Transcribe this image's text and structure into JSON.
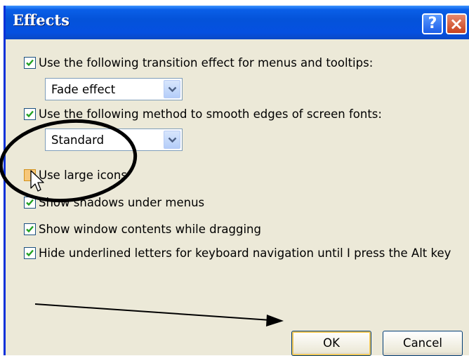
{
  "dialog": {
    "title": "Effects",
    "help_button": "?",
    "close_button": "×"
  },
  "options": {
    "transition_effect": {
      "label": "Use the following transition effect for menus and tooltips:",
      "checked": true,
      "selected": "Fade effect"
    },
    "smooth_edges": {
      "label": "Use the following method to smooth edges of screen fonts:",
      "checked": true,
      "selected": "Standard"
    },
    "large_icons": {
      "label": "Use large icons",
      "checked": false
    },
    "shadows": {
      "label": "Show shadows under menus",
      "checked": true
    },
    "window_contents": {
      "label": "Show window contents while dragging",
      "checked": true
    },
    "underlined_letters": {
      "label": "Hide underlined letters for keyboard navigation until I press the Alt key",
      "checked": true
    }
  },
  "buttons": {
    "ok": "OK",
    "cancel": "Cancel"
  },
  "colors": {
    "titlebar": "#0453d9",
    "dialog_bg": "#ece9d8",
    "annotation": "#000000"
  },
  "icons": [
    "help-icon",
    "close-icon",
    "checkmark-icon",
    "dropdown-arrow-icon",
    "mouse-cursor-icon"
  ]
}
